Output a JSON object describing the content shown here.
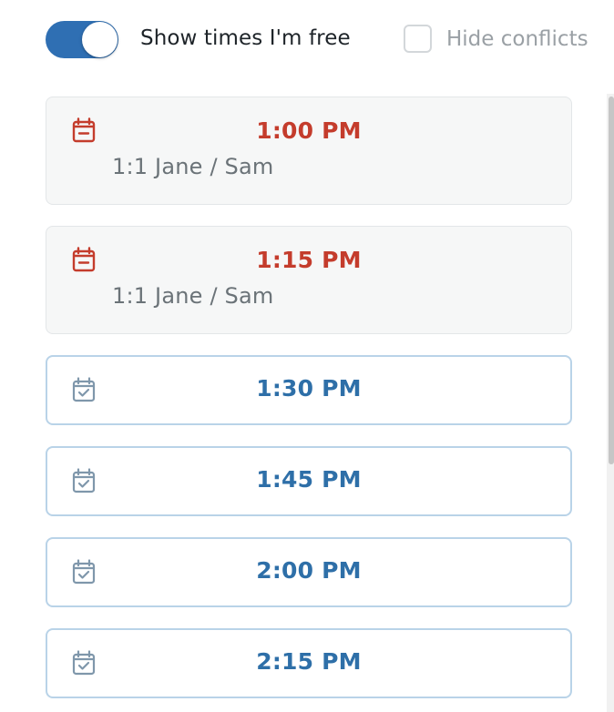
{
  "controls": {
    "show_free": {
      "label": "Show times I'm free",
      "on": true
    },
    "hide_conflicts": {
      "label": "Hide conflicts",
      "checked": false
    }
  },
  "colors": {
    "toggle_on": "#2f6fb3",
    "busy_time": "#c43c2c",
    "free_time": "#2e6fa8",
    "free_border": "#b9d3e8",
    "busy_bg": "#f6f7f7"
  },
  "slots": [
    {
      "time": "1:00 PM",
      "status": "busy",
      "event": "1:1 Jane / Sam",
      "icon": "calendar-minus-icon"
    },
    {
      "time": "1:15 PM",
      "status": "busy",
      "event": "1:1 Jane / Sam",
      "icon": "calendar-minus-icon"
    },
    {
      "time": "1:30 PM",
      "status": "free",
      "icon": "calendar-check-icon"
    },
    {
      "time": "1:45 PM",
      "status": "free",
      "icon": "calendar-check-icon"
    },
    {
      "time": "2:00 PM",
      "status": "free",
      "icon": "calendar-check-icon"
    },
    {
      "time": "2:15 PM",
      "status": "free",
      "icon": "calendar-check-icon"
    }
  ]
}
